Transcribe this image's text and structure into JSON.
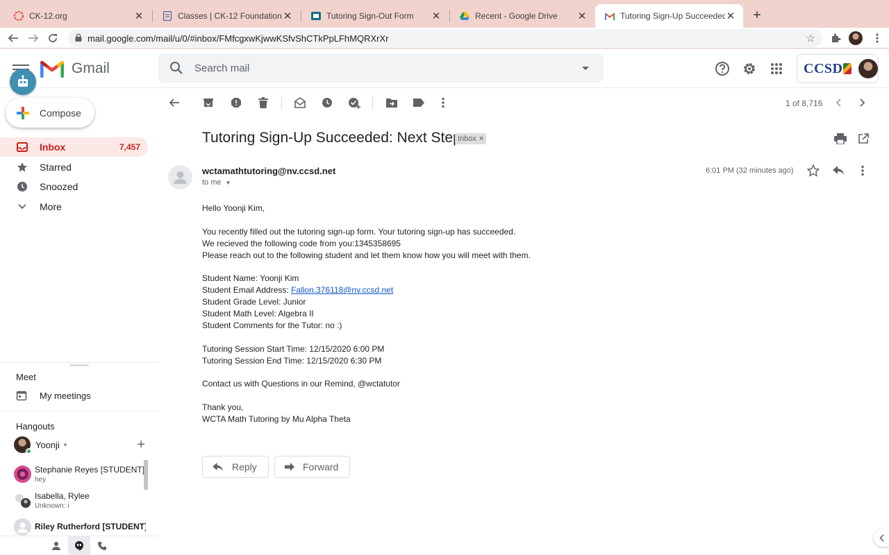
{
  "browser": {
    "tabs": [
      {
        "title": "CK-12.org",
        "active": false
      },
      {
        "title": "Classes | CK-12 Foundation",
        "active": false
      },
      {
        "title": "Tutoring Sign-Out Form",
        "active": false
      },
      {
        "title": "Recent - Google Drive",
        "active": false
      },
      {
        "title": "Tutoring Sign-Up Succeeded: N",
        "active": true
      }
    ],
    "close_glyph": "✕",
    "new_tab_glyph": "+",
    "url": "mail.google.com/mail/u/0/#inbox/FMfcgxwKjwwKSfvShCTkPpLFhMQRXrXr"
  },
  "header": {
    "app_name": "Gmail",
    "search_placeholder": "Search mail",
    "org_logo_text": "CCSD"
  },
  "float_badge_icon": "robot-badge-icon",
  "sidebar": {
    "compose_label": "Compose",
    "items": [
      {
        "label": "Inbox",
        "count": "7,457",
        "icon": "inbox-icon",
        "active": true
      },
      {
        "label": "Starred",
        "count": "",
        "icon": "star-icon",
        "active": false
      },
      {
        "label": "Snoozed",
        "count": "",
        "icon": "clock-icon",
        "active": false
      },
      {
        "label": "More",
        "count": "",
        "icon": "chevron-down-icon",
        "active": false
      }
    ],
    "meet_title": "Meet",
    "meet_item": "My meetings",
    "hangouts_title": "Hangouts",
    "hangouts_user": "Yoonji",
    "contacts": [
      {
        "name": "Stephanie Reyes [STUDENT]",
        "sub": "hey",
        "bold": false
      },
      {
        "name": "Isabella, Rylee",
        "sub": "Unknown: i",
        "bold": false
      },
      {
        "name": "Riley Rutherford [STUDENT]",
        "sub": "",
        "bold": true
      }
    ]
  },
  "toolbar": {
    "pager": "1 of 8,716"
  },
  "email": {
    "subject": "Tutoring Sign-Up Succeeded: Next Steps",
    "label": "Inbox",
    "label_remove": "×",
    "sender": "wctamathtutoring@nv.ccsd.net",
    "to": "to me",
    "time": "6:01 PM (32 minutes ago)",
    "body": {
      "greeting": "Hello Yoonji Kim,",
      "line1": "You recently filled out the tutoring sign-up form. Your tutoring sign-up has succeeded.",
      "line2": "We recieved the following code from you:1345358695",
      "line3": "Please reach out to the following student and let them know how you will meet with them.",
      "student_name": "Student Name: Yoonji Kim",
      "student_email_label": "Student Email Address: ",
      "student_email": "Fallon.376118@nv.ccsd.net",
      "student_grade": "Student Grade Level: Junior",
      "student_math": "Student Math Level: Algebra II",
      "student_comments": "Student Comments for the Tutor: no :)",
      "start_time": "Tutoring Session Start Time: 12/15/2020 6:00 PM",
      "end_time": "Tutoring Session End Time: 12/15/2020 6:30 PM",
      "contact": "Contact us with Questions in our Remind, @wctatutor",
      "thanks": "Thank you,",
      "signature": "WCTA Math Tutoring by Mu Alpha Theta"
    },
    "reply_label": "Reply",
    "forward_label": "Forward"
  },
  "colors": {
    "tabbar": "#f2d2cc",
    "inbox_active_bg": "#fce8e6",
    "inbox_active_text": "#c5221f",
    "link": "#1155cc"
  }
}
